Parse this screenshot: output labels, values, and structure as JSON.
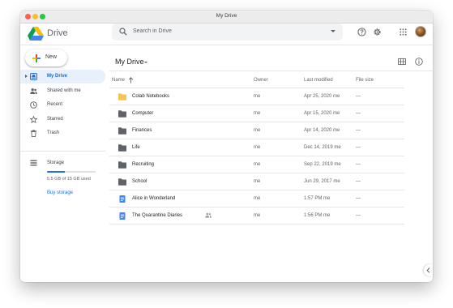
{
  "window": {
    "title": "My Drive"
  },
  "app": {
    "logo_text": "Drive"
  },
  "search": {
    "placeholder": "Search in Drive"
  },
  "new_button": {
    "label": "New"
  },
  "sidebar": {
    "items": [
      {
        "label": "My Drive",
        "icon": "my-drive-icon",
        "active": true
      },
      {
        "label": "Shared with me",
        "icon": "people-icon",
        "active": false
      },
      {
        "label": "Recent",
        "icon": "clock-icon",
        "active": false
      },
      {
        "label": "Starred",
        "icon": "star-icon",
        "active": false
      },
      {
        "label": "Trash",
        "icon": "trash-icon",
        "active": false
      }
    ],
    "storage": {
      "label": "Storage",
      "used_text": "5.5 GB of 15 GB used",
      "used_fraction": 0.37,
      "buy_label": "Buy storage"
    }
  },
  "main": {
    "breadcrumb": "My Drive",
    "columns": {
      "name": "Name",
      "owner": "Owner",
      "modified": "Last modified",
      "size": "File size"
    },
    "files": [
      {
        "name": "Colab Notebooks",
        "type": "folder",
        "color": "#f7c54f",
        "owner": "me",
        "modified": "Apr 25, 2020 me",
        "size": "—"
      },
      {
        "name": "Computer",
        "type": "folder",
        "color": "#5f6368",
        "owner": "me",
        "modified": "Apr 15, 2020 me",
        "size": "—"
      },
      {
        "name": "Finances",
        "type": "folder",
        "color": "#5f6368",
        "owner": "me",
        "modified": "Apr 14, 2020 me",
        "size": "—"
      },
      {
        "name": "Life",
        "type": "folder",
        "color": "#5f6368",
        "owner": "me",
        "modified": "Dec 14, 2019 me",
        "size": "—"
      },
      {
        "name": "Recruiting",
        "type": "folder",
        "color": "#5f6368",
        "owner": "me",
        "modified": "Sep 22, 2019 me",
        "size": "—"
      },
      {
        "name": "School",
        "type": "folder",
        "color": "#5f6368",
        "owner": "me",
        "modified": "Jun 29, 2017 me",
        "size": "—"
      },
      {
        "name": "Alice in Wonderland",
        "type": "doc",
        "color": "#4285f4",
        "owner": "me",
        "modified": "1:57 PM me",
        "size": "—"
      },
      {
        "name": "The Quarantine Diaries",
        "type": "doc",
        "color": "#4285f4",
        "owner": "me",
        "modified": "1:56 PM me",
        "size": "—",
        "shared": true
      }
    ]
  },
  "colors": {
    "accent": "#1a73e8",
    "active_bg": "#e8f0fe",
    "active_text": "#1967d2"
  }
}
